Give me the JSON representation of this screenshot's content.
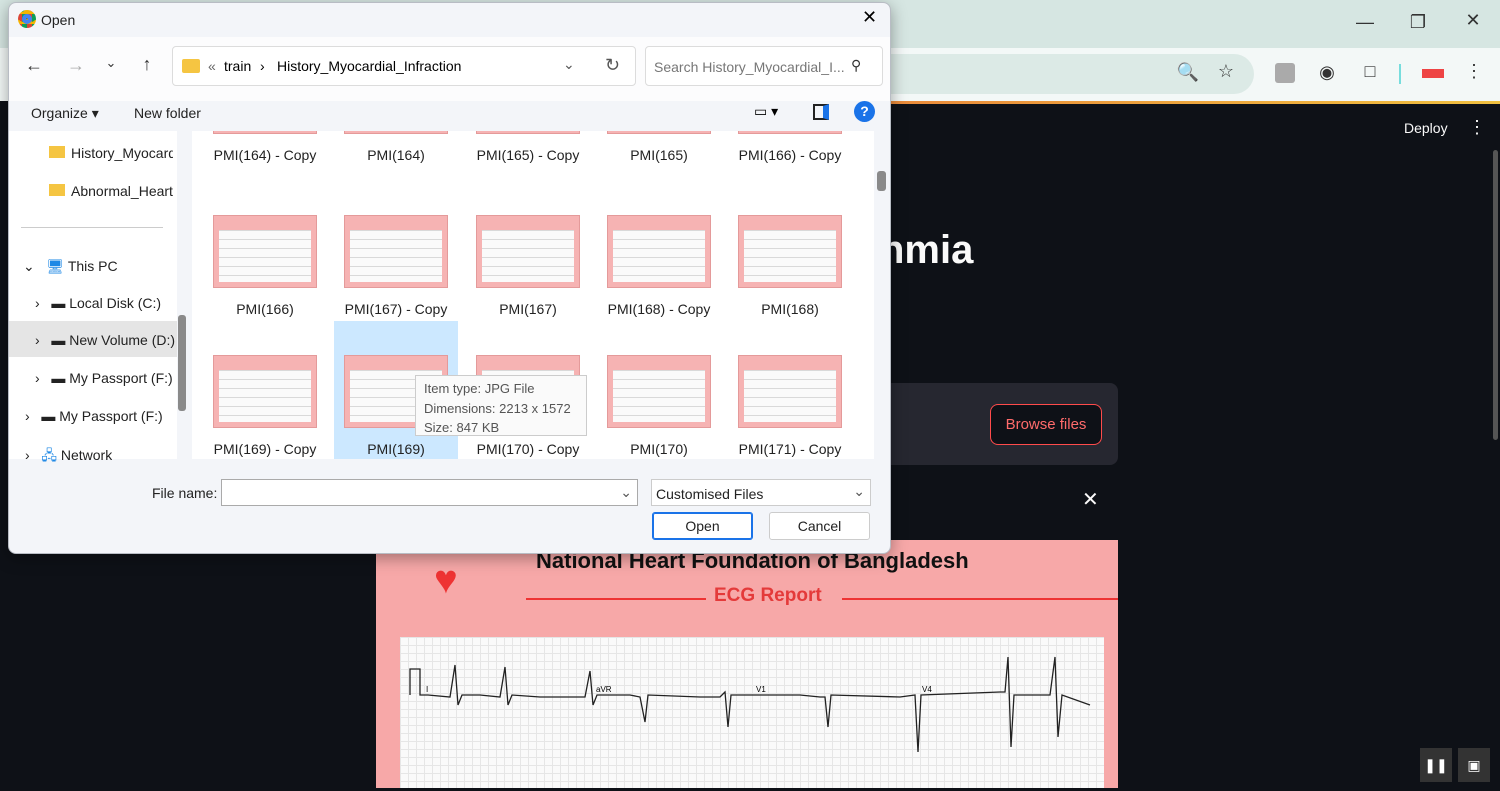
{
  "browser": {
    "toolbar_icons": [
      "zoom-out-icon",
      "star-icon",
      "profile-extension-icon",
      "panda-extension-icon",
      "puzzle-extension-icon",
      "ok-extension-icon",
      "kebab-menu-icon"
    ],
    "window_controls": [
      "minimize",
      "restore",
      "close"
    ]
  },
  "app": {
    "deploy": "Deploy",
    "title_partial": "hmia",
    "browse_files": "Browse files",
    "report": {
      "title": "National Heart Foundation of Bangladesh",
      "subtitle": "ECG Report",
      "leads": [
        "I",
        "aVR",
        "V1",
        "V4"
      ]
    }
  },
  "dialog": {
    "title": "Open",
    "breadcrumb": [
      "train",
      "History_Myocardial_Infraction"
    ],
    "breadcrumb_prefix": "«",
    "search_placeholder": "Search History_Myocardial_I...",
    "organize": "Organize",
    "new_folder": "New folder",
    "sidebar": [
      {
        "label": "History_Myocardial_Infraction"
      },
      {
        "label": "Abnormal_Heartbeat"
      },
      {
        "label": "This PC"
      },
      {
        "label": "Local Disk (C:)"
      },
      {
        "label": "New Volume (D:)"
      },
      {
        "label": "My Passport (F:)"
      },
      {
        "label": "My Passport (F:)"
      },
      {
        "label": "Network"
      }
    ],
    "files": [
      "PMI(164) - Copy",
      "PMI(164)",
      "PMI(165) - Copy",
      "PMI(165)",
      "PMI(166) - Copy",
      "PMI(166)",
      "PMI(167) - Copy",
      "PMI(167)",
      "PMI(168) - Copy",
      "PMI(168)",
      "PMI(169) - Copy",
      "PMI(169)",
      "PMI(170) - Copy",
      "PMI(170)",
      "PMI(171) - Copy"
    ],
    "selected_file": "PMI(169)",
    "tooltip": {
      "type": "Item type: JPG File",
      "dimensions": "Dimensions: 2213 x 1572",
      "size": "Size: 847 KB"
    },
    "file_name_label": "File name:",
    "file_name_value": "",
    "filter": "Customised Files",
    "open": "Open",
    "cancel": "Cancel"
  }
}
